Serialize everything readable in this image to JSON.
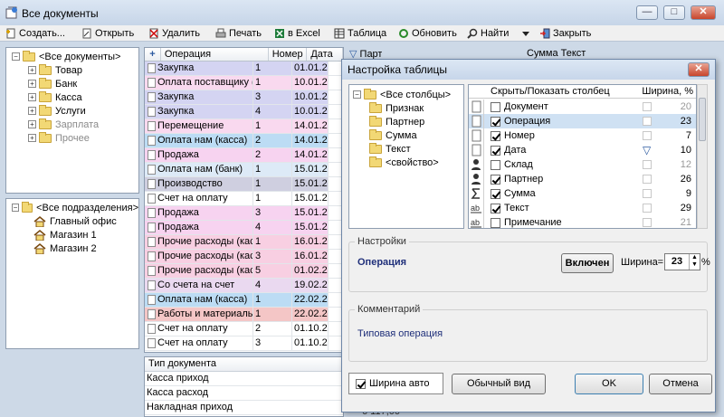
{
  "window": {
    "title": "Все документы",
    "controls": {
      "minimize": "—",
      "maximize": "□",
      "close": "✕"
    }
  },
  "toolbar": {
    "create": "Создать...",
    "open": "Открыть",
    "delete": "Удалить",
    "print": "Печать",
    "excel": "в Excel",
    "table": "Таблица",
    "refresh": "Обновить",
    "find": "Найти",
    "close": "Закрыть"
  },
  "doc_tree": {
    "root": "<Все документы>",
    "items": [
      {
        "label": "Товар",
        "disabled": false
      },
      {
        "label": "Банк",
        "disabled": false
      },
      {
        "label": "Касса",
        "disabled": false
      },
      {
        "label": "Услуги",
        "disabled": false
      },
      {
        "label": "Зарплата",
        "disabled": true
      },
      {
        "label": "Прочее",
        "disabled": true
      }
    ]
  },
  "dept_tree": {
    "root": "<Все подразделения>",
    "items": [
      "Главный офис",
      "Магазин 1",
      "Магазин 2"
    ]
  },
  "grid": {
    "columns": {
      "op": "Операция",
      "num": "Номер",
      "date": "Дата",
      "partner": "Партнер",
      "sum": "Сумма",
      "text": "Текст"
    },
    "rows": [
      {
        "op": "Закупка",
        "num": "1",
        "date": "01.01.2",
        "color": "#d4d4f2"
      },
      {
        "op": "Оплата поставщику (ба",
        "num": "1",
        "date": "10.01.2",
        "color": "#f9d9ef"
      },
      {
        "op": "Закупка",
        "num": "3",
        "date": "10.01.2",
        "color": "#d4d4f2"
      },
      {
        "op": "Закупка",
        "num": "4",
        "date": "10.01.2",
        "color": "#d4d4f2"
      },
      {
        "op": "Перемещение",
        "num": "1",
        "date": "14.01.2",
        "color": "#f9d9ef"
      },
      {
        "op": "Оплата нам (касса)",
        "num": "2",
        "date": "14.01.2",
        "color": "#bcdcf4"
      },
      {
        "op": "Продажа",
        "num": "2",
        "date": "14.01.2",
        "color": "#f7d3f0"
      },
      {
        "op": "Оплата нам (банк)",
        "num": "1",
        "date": "15.01.2",
        "color": "#ddeaf7"
      },
      {
        "op": "Производство",
        "num": "1",
        "date": "15.01.2",
        "color": "#cfcfe0"
      },
      {
        "op": "Счет на оплату",
        "num": "1",
        "date": "15.01.2",
        "color": "#ffffff"
      },
      {
        "op": "Продажа",
        "num": "3",
        "date": "15.01.2",
        "color": "#f7d3f0"
      },
      {
        "op": "Продажа",
        "num": "4",
        "date": "15.01.2",
        "color": "#f7d3f0"
      },
      {
        "op": "Прочие расходы (касса",
        "num": "1",
        "date": "16.01.2",
        "color": "#f8cfe2"
      },
      {
        "op": "Прочие расходы (касса",
        "num": "3",
        "date": "16.01.2",
        "color": "#f8cfe2"
      },
      {
        "op": "Прочие расходы (касса",
        "num": "5",
        "date": "01.02.2",
        "color": "#f8cfe2"
      },
      {
        "op": "Со счета на счет",
        "num": "4",
        "date": "19.02.2",
        "color": "#ead9f0"
      },
      {
        "op": "Оплата нам (касса)",
        "num": "1",
        "date": "22.02.2",
        "color": "#bcdcf4"
      },
      {
        "op": "Работы и материалы",
        "num": "1",
        "date": "22.02.2",
        "color": "#f4c6c6"
      },
      {
        "op": "Счет на оплату",
        "num": "2",
        "date": "01.10.2",
        "color": "#ffffff"
      },
      {
        "op": "Счет на оплату",
        "num": "3",
        "date": "01.10.2",
        "color": "#ffffff"
      }
    ]
  },
  "bottom_grid": {
    "header": "Тип документа",
    "rows": [
      "Касса приход",
      "Касса расход",
      "Накладная приход"
    ],
    "partial_value": "6 117,00"
  },
  "dialog": {
    "title": "Настройка таблицы",
    "tree_root": "<Все столбцы>",
    "tree_items": [
      "Признак",
      "Партнер",
      "Сумма",
      "Текст",
      "<свойство>"
    ],
    "list_header_show": "Скрыть/Показать столбец",
    "list_header_width": "Ширина, %",
    "columns": [
      {
        "icon": "doc",
        "label": "Документ",
        "checked": false,
        "width": "20",
        "greyed": true,
        "selected": false
      },
      {
        "icon": "doc",
        "label": "Операция",
        "checked": true,
        "width": "23",
        "greyed": false,
        "selected": true
      },
      {
        "icon": "doc",
        "label": "Номер",
        "checked": true,
        "width": "7",
        "greyed": false,
        "selected": false
      },
      {
        "icon": "doc",
        "label": "Дата",
        "checked": true,
        "width": "10",
        "greyed": false,
        "selected": false
      },
      {
        "icon": "person",
        "label": "Склад",
        "checked": false,
        "width": "12",
        "greyed": true,
        "selected": false
      },
      {
        "icon": "person",
        "label": "Партнер",
        "checked": true,
        "width": "26",
        "greyed": false,
        "selected": false
      },
      {
        "icon": "sigma",
        "label": "Сумма",
        "checked": true,
        "width": "9",
        "greyed": false,
        "selected": false
      },
      {
        "icon": "ab",
        "label": "Текст",
        "checked": true,
        "width": "29",
        "greyed": false,
        "selected": false
      },
      {
        "icon": "ab",
        "label": "Примечание",
        "checked": false,
        "width": "21",
        "greyed": true,
        "selected": false
      }
    ],
    "settings_group": "Настройки",
    "selected_column": "Операция",
    "toggle_label": "Включен",
    "width_label": "Ширина=",
    "width_value": "23",
    "percent": "%",
    "comment_group": "Комментарий",
    "comment_text": "Типовая операция",
    "auto_width_label": "Ширина авто",
    "normal_view": "Обычный вид",
    "ok": "OK",
    "cancel": "Отмена"
  }
}
